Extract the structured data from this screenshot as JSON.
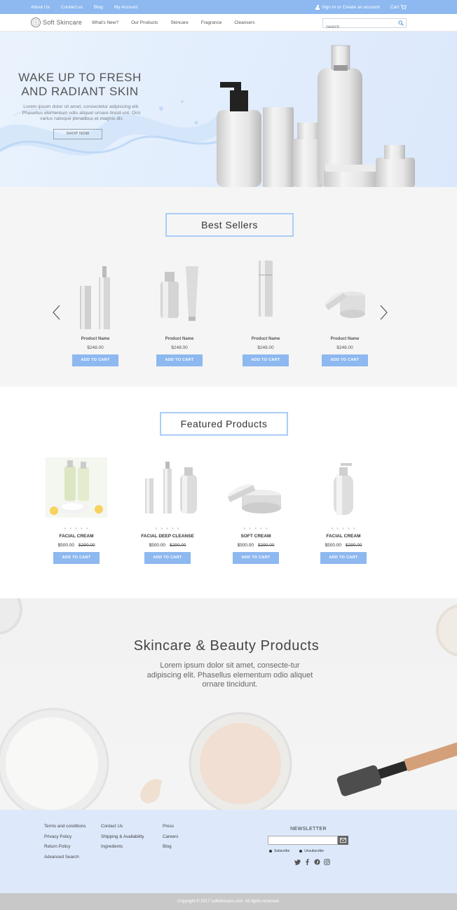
{
  "topbar": {
    "links": [
      "About Us",
      "Contact us",
      "Blog",
      "My Account"
    ],
    "signin": "Sign In or Create an account",
    "cart": "Cart"
  },
  "nav": {
    "logo": "Soft Skincare",
    "items": [
      "What's New?",
      "Our Products",
      "Skincare",
      "Fragrance",
      "Cleansers"
    ],
    "search_placeholder": "Search"
  },
  "hero": {
    "title": "WAKE UP TO FRESH\nAND RADIANT SKIN",
    "text": "Lorem ipsum dolor sit amet, consectetur adipiscing elit. Phasellus elementum odio aliquet ornare tincid-unt. Orci varius natoque penatibus et magnis dis",
    "button": "SHOP NOW"
  },
  "best_sellers": {
    "title": "Best Sellers",
    "products": [
      {
        "name": "Product Name",
        "price": "$248.00",
        "button": "ADD TO CART"
      },
      {
        "name": "Product Name",
        "price": "$248.00",
        "button": "ADD TO CART"
      },
      {
        "name": "Product Name",
        "price": "$248.00",
        "button": "ADD TO CART"
      },
      {
        "name": "Product Name",
        "price": "$248.00",
        "button": "ADD TO CART"
      }
    ]
  },
  "featured": {
    "title": "Featured Products",
    "stars": "★ ★ ★ ★ ★",
    "products": [
      {
        "name": "FACIAL CREAM",
        "price": "$500.00",
        "old_price": "$290.00",
        "button": "ADD TO CART"
      },
      {
        "name": "FACIAL DEEP CLEANSE",
        "price": "$500.00",
        "old_price": "$290.00",
        "button": "ADD TO CART"
      },
      {
        "name": "SOFT CREAM",
        "price": "$500.00",
        "old_price": "$290.00",
        "button": "ADD TO CART"
      },
      {
        "name": "FACIAL CREAM",
        "price": "$500.00",
        "old_price": "$290.00",
        "button": "ADD TO CART"
      }
    ]
  },
  "banner": {
    "title": "Skincare & Beauty Products",
    "text": "Lorem ipsum dolor sit amet, consecte-tur adipiscing elit. Phasellus elementum odio aliquet ornare tincidunt."
  },
  "footer": {
    "col1": [
      "Terms and conditions",
      "Privacy Policy",
      "Return Policy",
      "Advanced Search"
    ],
    "col2": [
      "Contact Us",
      "Shipping & Availability",
      "Ingredients"
    ],
    "col3": [
      "Press",
      "Careers",
      "Blog"
    ],
    "newsletter_title": "NEWSLETTER",
    "subscribe": "Subscribe",
    "unsubscribe": "Unsubscribe",
    "copyright": "Copyright © 2017 softskincare.com.  All rights reserved."
  },
  "colors": {
    "accent": "#8db8f0",
    "footer_bg": "#dde9fb",
    "hero_bg": "#e3eefd"
  }
}
